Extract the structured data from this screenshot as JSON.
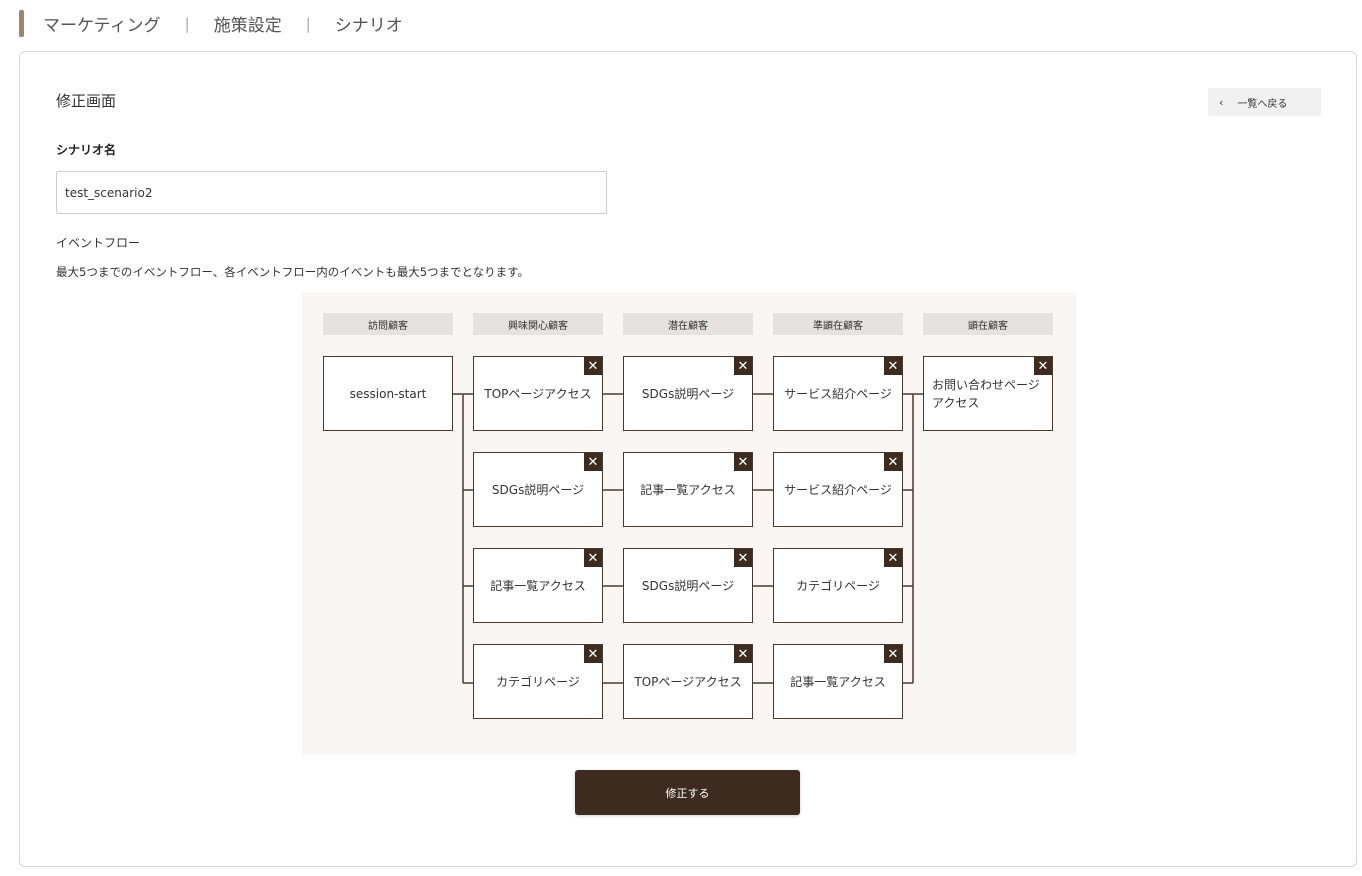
{
  "breadcrumb": {
    "items": [
      "マーケティング",
      "施策設定",
      "シナリオ"
    ],
    "separator": "|"
  },
  "page": {
    "title": "修正画面",
    "back_label": "一覧へ戻る",
    "back_icon": "chevron-left-icon"
  },
  "form": {
    "name_label": "シナリオ名",
    "name_value": "test_scenario2",
    "flow_label": "イベントフロー",
    "flow_note": "最大5つまでのイベントフロー、各イベントフロー内のイベントも最大5つまでとなります。",
    "submit_label": "修正する"
  },
  "flow": {
    "columns": [
      "訪問顧客",
      "興味関心顧客",
      "潜在顧客",
      "準顕在顧客",
      "顕在顧客"
    ],
    "start_node": "session-start",
    "rows": [
      [
        "TOPページアクセス",
        "SDGs説明ページ",
        "サービス紹介ページ"
      ],
      [
        "SDGs説明ページ",
        "記事一覧アクセス",
        "サービス紹介ページ"
      ],
      [
        "記事一覧アクセス",
        "SDGs説明ページ",
        "カテゴリページ"
      ],
      [
        "カテゴリページ",
        "TOPページアクセス",
        "記事一覧アクセス"
      ]
    ],
    "end_node": "お問い合わせページアクセス",
    "close_symbol": "✕"
  },
  "colors": {
    "accent": "#3d2b1f",
    "breadcrumb_bar": "#9b8674",
    "flow_bg": "#f9f6f3",
    "header_bg": "#e5e2df"
  }
}
